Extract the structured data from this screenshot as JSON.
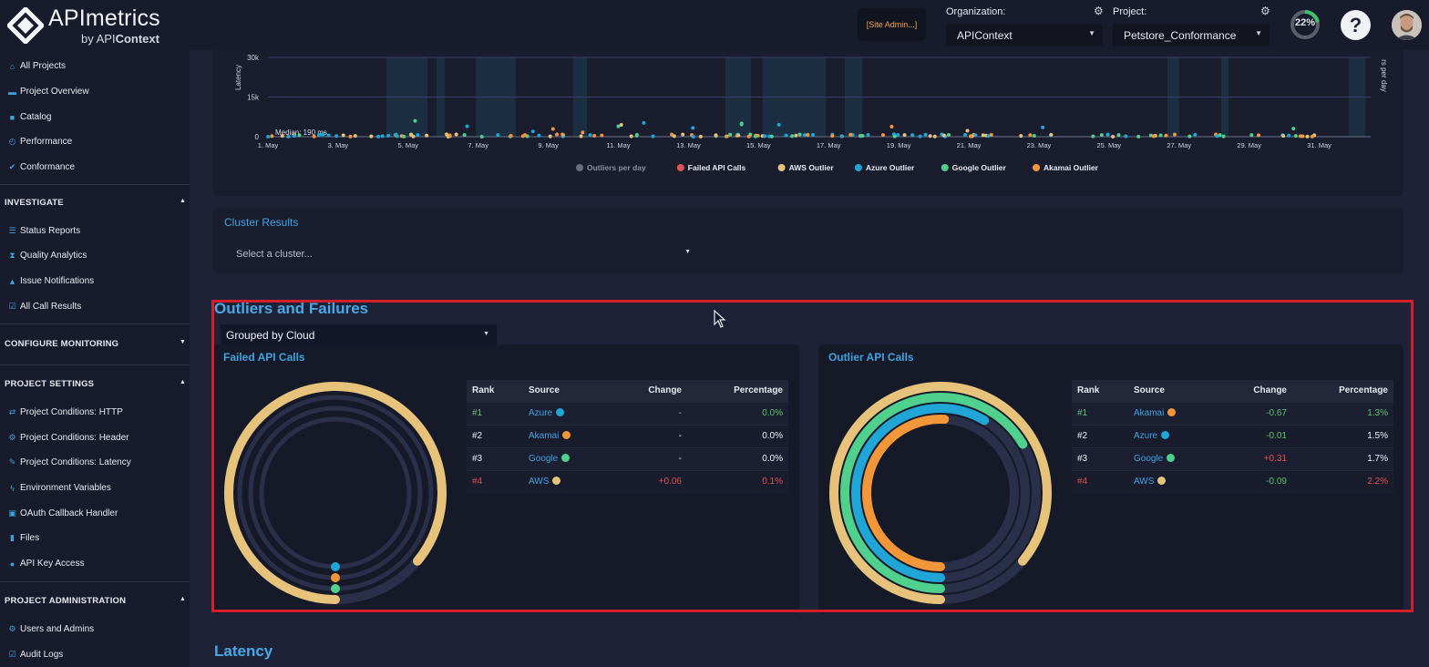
{
  "header": {
    "logo_main": "APImetrics",
    "logo_by": "by API",
    "logo_bold": "Context",
    "site_admin": "[Site Admin...]",
    "organization_label": "Organization:",
    "organization_value": "APIContext",
    "project_label": "Project:",
    "project_value": "Petstore_Conformance",
    "progress_text": "22%",
    "progress_fraction": 0.22,
    "help": "?"
  },
  "sidebar": {
    "top_items": [
      {
        "label": "All Projects",
        "icon": "home-icon"
      },
      {
        "label": "Project Overview",
        "icon": "folder-icon"
      },
      {
        "label": "Catalog",
        "icon": "book-icon"
      },
      {
        "label": "Performance",
        "icon": "dashboard-icon"
      },
      {
        "label": "Conformance",
        "icon": "check-icon"
      }
    ],
    "investigate": {
      "title": "INVESTIGATE",
      "items": [
        {
          "label": "Status Reports",
          "icon": "list-icon"
        },
        {
          "label": "Quality Analytics",
          "icon": "hourglass-icon"
        },
        {
          "label": "Issue Notifications",
          "icon": "bell-icon"
        },
        {
          "label": "All Call Results",
          "icon": "check-square-icon"
        }
      ]
    },
    "configure_monitoring": {
      "title": "CONFIGURE MONITORING"
    },
    "project_settings": {
      "title": "PROJECT SETTINGS",
      "items": [
        {
          "label": "Project Conditions: HTTP",
          "icon": "arrows-icon"
        },
        {
          "label": "Project Conditions: Header",
          "icon": "gear-icon"
        },
        {
          "label": "Project Conditions: Latency",
          "icon": "wrench-icon"
        },
        {
          "label": "Environment Variables",
          "icon": "bolt-icon"
        },
        {
          "label": "OAuth Callback Handler",
          "icon": "lock-icon"
        },
        {
          "label": "Files",
          "icon": "file-icon"
        },
        {
          "label": "API Key Access",
          "icon": "key-icon"
        }
      ]
    },
    "project_administration": {
      "title": "PROJECT ADMINISTRATION",
      "items": [
        {
          "label": "Users and Admins",
          "icon": "gear-icon"
        },
        {
          "label": "Audit Logs",
          "icon": "check-square-icon"
        }
      ]
    }
  },
  "chart_data": {
    "type": "scatter",
    "ylabel": "Latency",
    "y2label": "rs per day",
    "y_ticks": [
      "30k",
      "15k",
      "0"
    ],
    "ylim": [
      0,
      30000
    ],
    "x_ticks": [
      "1. May",
      "3. May",
      "5. May",
      "7. May",
      "9. May",
      "11. May",
      "13. May",
      "15. May",
      "17. May",
      "19. May",
      "21. May",
      "23. May",
      "25. May",
      "27. May",
      "29. May",
      "31. May"
    ],
    "annotation": "Median: 190 ms",
    "legend": [
      {
        "name": "Outliers per day",
        "color": "#6b6f7d"
      },
      {
        "name": "Failed API Calls",
        "color": "#e2504f"
      },
      {
        "name": "AWS Outlier",
        "color": "#e7c27a"
      },
      {
        "name": "Azure Outlier",
        "color": "#1fa6d6"
      },
      {
        "name": "Google Outlier",
        "color": "#4fd08c"
      },
      {
        "name": "Akamai Outlier",
        "color": "#f2963a"
      }
    ],
    "grid": true,
    "legend_position": "bottom"
  },
  "cluster": {
    "title": "Cluster Results",
    "placeholder": "Select a cluster..."
  },
  "outliers": {
    "title": "Outliers and Failures",
    "group_by": "Grouped by Cloud",
    "columns": [
      "Rank",
      "Source",
      "Change",
      "Percentage"
    ],
    "failed": {
      "title": "Failed API Calls",
      "rows": [
        {
          "rank": "#1",
          "source": "Azure",
          "color": "#1fa6d6",
          "change": "-",
          "percentage": "0.0%",
          "pct": 0.0
        },
        {
          "rank": "#2",
          "source": "Akamai",
          "color": "#f2963a",
          "change": "-",
          "percentage": "0.0%",
          "pct": 0.0
        },
        {
          "rank": "#3",
          "source": "Google",
          "color": "#4fd08c",
          "change": "-",
          "percentage": "0.0%",
          "pct": 0.0
        },
        {
          "rank": "#4",
          "source": "AWS",
          "color": "#e7c27a",
          "change": "+0.06",
          "percentage": "0.1%",
          "pct": 0.1
        }
      ]
    },
    "outlier": {
      "title": "Outlier API Calls",
      "rows": [
        {
          "rank": "#1",
          "source": "Akamai",
          "color": "#f2963a",
          "change": "-0.67",
          "percentage": "1.3%",
          "pct": 1.3
        },
        {
          "rank": "#2",
          "source": "Azure",
          "color": "#1fa6d6",
          "change": "-0.01",
          "percentage": "1.5%",
          "pct": 1.5
        },
        {
          "rank": "#3",
          "source": "Google",
          "color": "#4fd08c",
          "change": "+0.31",
          "percentage": "1.7%",
          "pct": 1.7
        },
        {
          "rank": "#4",
          "source": "AWS",
          "color": "#e7c27a",
          "change": "-0.09",
          "percentage": "2.2%",
          "pct": 2.2
        }
      ]
    }
  },
  "latency": {
    "title": "Latency"
  }
}
